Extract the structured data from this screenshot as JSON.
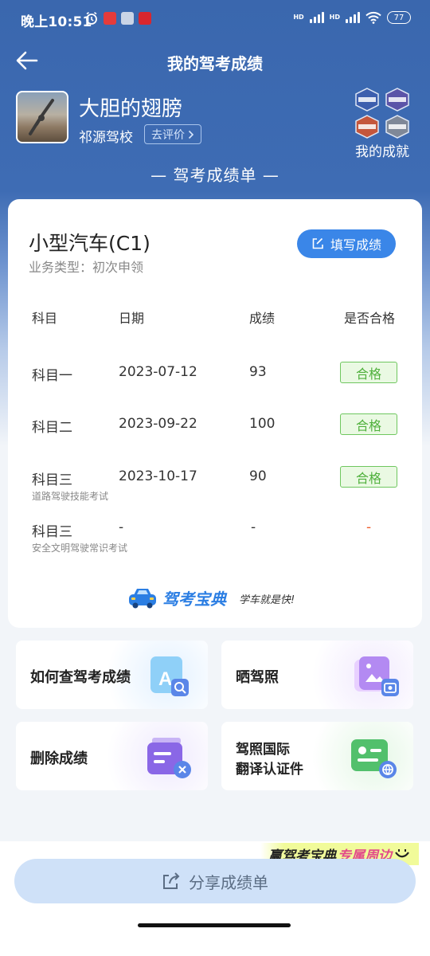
{
  "status_bar": {
    "time": "晚上10:51",
    "hd1": "HD",
    "hd2": "HD",
    "battery": "77"
  },
  "header": {
    "title": "我的驾考成绩"
  },
  "profile": {
    "name": "大胆的翅膀",
    "school": "祁源驾校",
    "review_label": "去评价"
  },
  "achievements": {
    "label": "我的成就",
    "badges": [
      "blue-badge",
      "purple-badge",
      "orange-badge",
      "gray-badge"
    ]
  },
  "sheet_title": "— 驾考成绩单 —",
  "card": {
    "license": "小型汽车(C1)",
    "business_type": "业务类型：初次申领",
    "fill_label": "填写成绩",
    "columns": [
      "科目",
      "日期",
      "成绩",
      "是否合格"
    ],
    "rows": [
      {
        "subject": "科目一",
        "date": "2023-07-12",
        "score": "93",
        "result": "合格",
        "note": ""
      },
      {
        "subject": "科目二",
        "date": "2023-09-22",
        "score": "100",
        "result": "合格",
        "note": ""
      },
      {
        "subject": "科目三",
        "date": "2023-10-17",
        "score": "90",
        "result": "合格",
        "note": "道路驾驶技能考试"
      },
      {
        "subject": "科目三",
        "date": "-",
        "score": "-",
        "result": "-",
        "note": "安全文明驾驶常识考试"
      }
    ],
    "brand_name": "驾考宝典",
    "brand_slogan": "学车就是快!"
  },
  "tiles": {
    "query": "如何查驾考成绩",
    "show_license": "晒驾照",
    "delete": "删除成绩",
    "intl_line1": "驾照国际",
    "intl_line2": "翻译认证件"
  },
  "promo": {
    "part1": "赢驾考宝典",
    "part2": "专属周边"
  },
  "share_label": "分享成绩单",
  "colors": {
    "header_blue": "#3e6cb4",
    "accent_blue": "#3a86e8",
    "pass_green": "#4fb03c"
  }
}
